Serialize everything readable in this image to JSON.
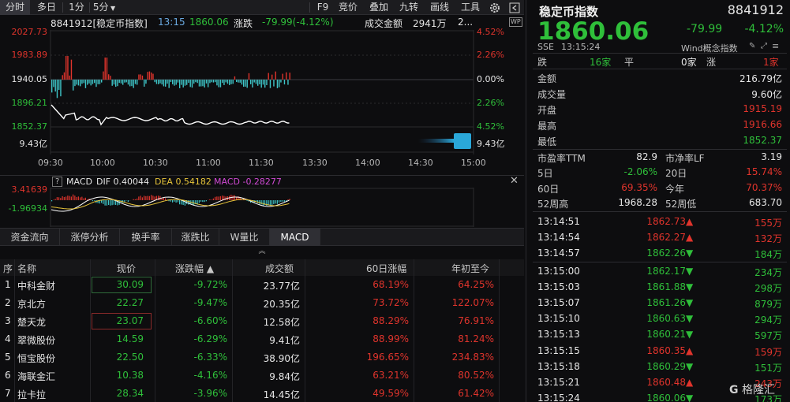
{
  "toolbar": {
    "items": [
      "分时",
      "多日",
      "1分",
      "5分",
      "F9",
      "竞价",
      "叠加",
      "九转",
      "画线",
      "工具"
    ]
  },
  "info": {
    "code_name": "8841912[稳定币指数]",
    "time": "13:15",
    "price": "1860.06",
    "change_label": "涨跌",
    "change_value": "-79.99(-4.12%)",
    "turnover_label": "成交金额",
    "turnover_value": "2941万",
    "trail": "2..."
  },
  "chart": {
    "y_left": [
      "2027.73",
      "1983.89",
      "1940.05",
      "1896.21",
      "1852.37"
    ],
    "y_right": [
      "4.52%",
      "2.26%",
      "0.00%",
      "2.26%",
      "4.52%"
    ],
    "vol_label": "9.43亿",
    "vol_label_right": "9.43亿",
    "x_ticks": [
      "09:30",
      "10:00",
      "10:30",
      "11:00",
      "11:30",
      "13:30",
      "14:00",
      "14:30",
      "15:00"
    ],
    "wp_badge": "WP"
  },
  "macd": {
    "y_top": "3.41639",
    "y_bot": "-1.96934",
    "help": "?",
    "name": "MACD",
    "dif": "DIF 0.40044",
    "dea": "DEA 0.54182",
    "macd": "MACD -0.28277"
  },
  "tabs": [
    "资金流向",
    "涨停分析",
    "换手率",
    "涨跌比",
    "W量比",
    "MACD"
  ],
  "table": {
    "headers": [
      "序",
      "名称",
      "现价",
      "涨跌幅 ▲",
      "成交额",
      "60日涨幅",
      "年初至今"
    ],
    "rows": [
      {
        "idx": "1",
        "name": "中科金财",
        "price": "30.09",
        "chg": "-9.72%",
        "amt": "23.77亿",
        "d60": "68.19%",
        "ytd": "64.25%"
      },
      {
        "idx": "2",
        "name": "京北方",
        "price": "22.27",
        "chg": "-9.47%",
        "amt": "20.35亿",
        "d60": "73.72%",
        "ytd": "122.07%"
      },
      {
        "idx": "3",
        "name": "楚天龙",
        "price": "23.07",
        "chg": "-6.60%",
        "amt": "12.58亿",
        "d60": "88.29%",
        "ytd": "76.91%"
      },
      {
        "idx": "4",
        "name": "翠微股份",
        "price": "14.59",
        "chg": "-6.29%",
        "amt": "9.41亿",
        "d60": "88.99%",
        "ytd": "81.24%"
      },
      {
        "idx": "5",
        "name": "恒宝股份",
        "price": "22.50",
        "chg": "-6.33%",
        "amt": "38.90亿",
        "d60": "196.65%",
        "ytd": "234.83%"
      },
      {
        "idx": "6",
        "name": "海联金汇",
        "price": "10.38",
        "chg": "-4.16%",
        "amt": "9.84亿",
        "d60": "63.21%",
        "ytd": "80.52%"
      },
      {
        "idx": "7",
        "name": "拉卡拉",
        "price": "28.34",
        "chg": "-3.96%",
        "amt": "14.45亿",
        "d60": "49.59%",
        "ytd": "61.42%"
      }
    ]
  },
  "right": {
    "title": "稳定币指数",
    "code": "8841912",
    "price": "1860.06",
    "change": "-79.99",
    "change_pct": "-4.12%",
    "exchange": "SSE",
    "time": "13:15:24",
    "concept": "Wind概念指数",
    "breadth": {
      "down_label": "跌",
      "down_val": "16家",
      "flat_label": "平",
      "flat_val": "0家",
      "up_label": "涨",
      "up_val": "1家"
    },
    "stats": [
      {
        "label": "金额",
        "value": "216.79亿"
      },
      {
        "label": "成交量",
        "value": "9.60亿"
      },
      {
        "label": "开盘",
        "value": "1915.19"
      },
      {
        "label": "最高",
        "value": "1916.66"
      },
      {
        "label": "最低",
        "value": "1852.37"
      }
    ],
    "ratios": {
      "pe_label": "市盈率TTM",
      "pe_val": "82.9",
      "pb_label": "市净率LF",
      "pb_val": "3.19",
      "d5_label": "5日",
      "d5_val": "-2.06%",
      "d20_label": "20日",
      "d20_val": "15.74%",
      "d60_label": "60日",
      "d60_val": "69.35%",
      "ytd_label": "今年",
      "ytd_val": "70.37%",
      "h52_label": "52周高",
      "h52_val": "1968.28",
      "l52_label": "52周低",
      "l52_val": "683.70"
    },
    "trades": [
      {
        "t": "13:14:51",
        "p": "1862.73",
        "dir": "up",
        "v": "155万"
      },
      {
        "t": "13:14:54",
        "p": "1862.27",
        "dir": "up",
        "v": "132万"
      },
      {
        "t": "13:14:57",
        "p": "1862.26",
        "dir": "down",
        "v": "184万"
      },
      {
        "t": "13:15:00",
        "p": "1862.17",
        "dir": "down",
        "v": "234万"
      },
      {
        "t": "13:15:03",
        "p": "1861.88",
        "dir": "down",
        "v": "298万"
      },
      {
        "t": "13:15:07",
        "p": "1861.26",
        "dir": "down",
        "v": "879万"
      },
      {
        "t": "13:15:10",
        "p": "1860.63",
        "dir": "down",
        "v": "294万"
      },
      {
        "t": "13:15:13",
        "p": "1860.21",
        "dir": "down",
        "v": "597万"
      },
      {
        "t": "13:15:15",
        "p": "1860.35",
        "dir": "up",
        "v": "159万"
      },
      {
        "t": "13:15:18",
        "p": "1860.29",
        "dir": "down",
        "v": "151万"
      },
      {
        "t": "13:15:21",
        "p": "1860.48",
        "dir": "up",
        "v": "243万"
      },
      {
        "t": "13:15:24",
        "p": "1860.06",
        "dir": "down",
        "v": "173万"
      }
    ]
  },
  "watermark": "格隆汇",
  "colors": {
    "up": "#e0342c",
    "down": "#2fbf3a",
    "price_line": "#ffffff",
    "macd_dif": "#ffffff",
    "macd_dea": "#e8c53a"
  }
}
